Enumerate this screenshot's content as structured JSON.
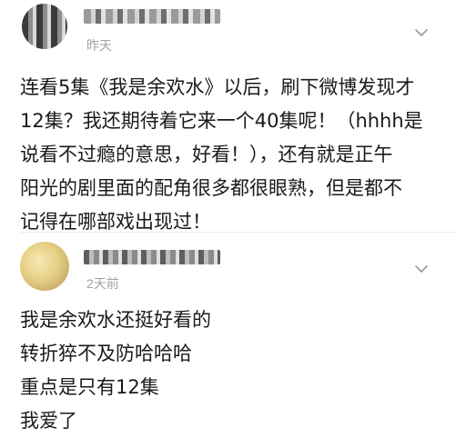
{
  "comments": [
    {
      "time": "昨天",
      "lines": [
        "连看5集《我是余欢水》以后，刷下微博发现才",
        "12集？我还期待着它来一个40集呢！（hhhh是",
        "说看不过瘾的意思，好看！），还有就是正午",
        "阳光的剧里面的配角很多都很眼熟，但是都不",
        "记得在哪部戏出现过！"
      ]
    },
    {
      "time": "2天前",
      "lines": [
        "我是余欢水还挺好看的",
        "转折猝不及防哈哈哈",
        "重点是只有12集",
        "我爱了"
      ]
    }
  ],
  "icons": {
    "more": "chevron-down-icon"
  },
  "colors": {
    "text": "#1a1a1a",
    "meta": "#a3a3a3"
  }
}
